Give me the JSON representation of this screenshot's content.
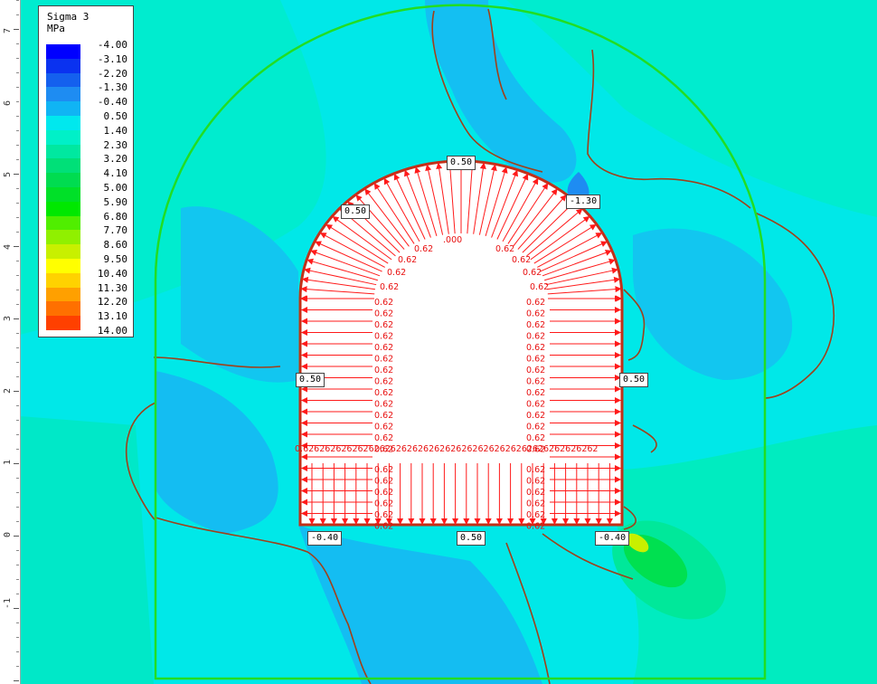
{
  "legend": {
    "title": "Sigma 3",
    "unit": "MPa",
    "entries": [
      {
        "value": "-4.00",
        "color": "#0000ff"
      },
      {
        "value": "-3.10",
        "color": "#0a32f0"
      },
      {
        "value": "-2.20",
        "color": "#1460ee"
      },
      {
        "value": "-1.30",
        "color": "#1e8cf2"
      },
      {
        "value": "-0.40",
        "color": "#10b4f4"
      },
      {
        "value": "0.50",
        "color": "#00e8ee"
      },
      {
        "value": "1.40",
        "color": "#00f0c8"
      },
      {
        "value": "2.30",
        "color": "#00e8a0"
      },
      {
        "value": "3.20",
        "color": "#00e078"
      },
      {
        "value": "4.10",
        "color": "#00dc50"
      },
      {
        "value": "5.00",
        "color": "#00e028"
      },
      {
        "value": "5.90",
        "color": "#00e800"
      },
      {
        "value": "6.80",
        "color": "#50ee00"
      },
      {
        "value": "7.70",
        "color": "#90f000"
      },
      {
        "value": "8.60",
        "color": "#c8f000"
      },
      {
        "value": "9.50",
        "color": "#ffff00"
      },
      {
        "value": "10.40",
        "color": "#ffd200"
      },
      {
        "value": "11.30",
        "color": "#ffa000"
      },
      {
        "value": "12.20",
        "color": "#ff7000"
      },
      {
        "value": "13.10",
        "color": "#ff4000"
      },
      {
        "value": "14.00",
        "color": "#ff0000"
      }
    ]
  },
  "ruler": {
    "labels": [
      "7",
      "6",
      "5",
      "4",
      "3",
      "2",
      "1",
      "0",
      "-1"
    ]
  },
  "callouts": [
    "0.50",
    "-1.30",
    "0.50",
    "0.50",
    "0.50",
    "-0.40",
    "0.50",
    "-0.40"
  ],
  "load": {
    "value": "0.62",
    "arch_labels": [
      ".000",
      "0.62",
      "0.62",
      "0.62",
      "0.62",
      "0.62",
      "0.62",
      "0.62",
      "0.62"
    ],
    "row_text": "0.626262626262626262626262626262626262626262626262626262",
    "count_vertical": 14
  },
  "colors": {
    "background": "#00e8e8",
    "boundary": "#22dd22",
    "excavation": "#c23018",
    "load": "#ff1a1a",
    "contour": "#a0401a"
  }
}
